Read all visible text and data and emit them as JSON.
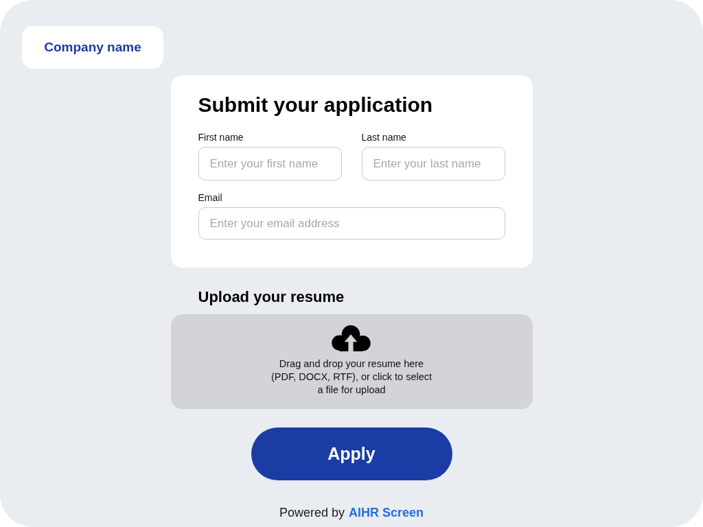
{
  "company": {
    "name": "Company name"
  },
  "application_form": {
    "title": "Submit your application",
    "fields": [
      {
        "label": "First name",
        "placeholder": "Enter your first name"
      },
      {
        "label": "Last name",
        "placeholder": "Enter your last name"
      },
      {
        "label": "Email",
        "placeholder": "Enter your email address"
      }
    ]
  },
  "upload": {
    "heading": "Upload your resume",
    "dropzone_text": "Drag and drop your resume here\n(PDF, DOCX, RTF), or click to select\na file for upload"
  },
  "apply_button": {
    "label": "Apply"
  },
  "footer": {
    "text": "Powered by",
    "link": "AIHR Screen"
  }
}
